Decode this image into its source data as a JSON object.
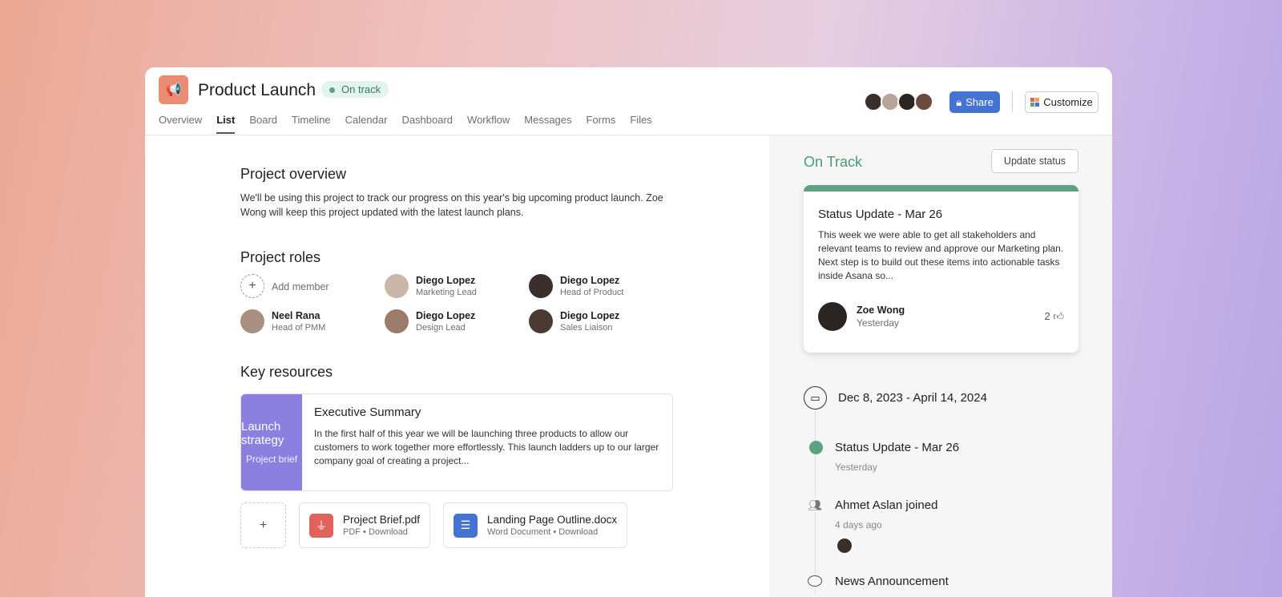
{
  "project": {
    "title": "Product Launch",
    "status": "On track"
  },
  "tabs": [
    "Overview",
    "List",
    "Board",
    "Timeline",
    "Calendar",
    "Dashboard",
    "Workflow",
    "Messages",
    "Forms",
    "Files"
  ],
  "header": {
    "share": "Share",
    "customize": "Customize"
  },
  "overview": {
    "heading": "Project overview",
    "text": "We'll be using this project to track our progress on this year's big upcoming product launch. Zoe Wong will keep this project updated with the latest launch plans."
  },
  "roles": {
    "heading": "Project roles",
    "add": "Add member",
    "members": [
      {
        "name": "Diego Lopez",
        "role": "Marketing Lead"
      },
      {
        "name": "Diego Lopez",
        "role": "Head of Product"
      },
      {
        "name": "Neel Rana",
        "role": "Head of PMM"
      },
      {
        "name": "Diego Lopez",
        "role": "Design Lead"
      },
      {
        "name": "Diego Lopez",
        "role": "Sales Liaison"
      }
    ]
  },
  "resources": {
    "heading": "Key resources",
    "brief_title": "Launch strategy",
    "brief_sub": "Project brief",
    "summary_title": "Executive Summary",
    "summary_text": "In the first half of this year we will be launching three products to allow our customers to work together more effortlessly. This launch ladders up to our larger company goal of creating a project...",
    "add": "+",
    "files": [
      {
        "name": "Project Brief.pdf",
        "type": "PDF",
        "action": "Download"
      },
      {
        "name": "Landing Page Outline.docx",
        "type": "Word Document",
        "action": "Download"
      }
    ]
  },
  "side": {
    "status": "On Track",
    "update_btn": "Update status",
    "card": {
      "title": "Status Update - Mar 26",
      "text": "This week we were able to get all stakeholders and relevant teams to review and approve our Marketing plan. Next step is to build out these items into actionable tasks inside Asana so...",
      "author": "Zoe Wong",
      "time": "Yesterday",
      "likes": "2"
    },
    "dates": "Dec 8, 2023 - April 14, 2024",
    "timeline": [
      {
        "title": "Status Update - Mar 26",
        "time": "Yesterday"
      },
      {
        "title": "Ahmet Aslan joined",
        "time": "4 days ago"
      },
      {
        "title": "News Announcement"
      }
    ]
  },
  "colors": {
    "accent": "#4573d2",
    "green": "#5da283",
    "brief": "#8b7fe0"
  }
}
